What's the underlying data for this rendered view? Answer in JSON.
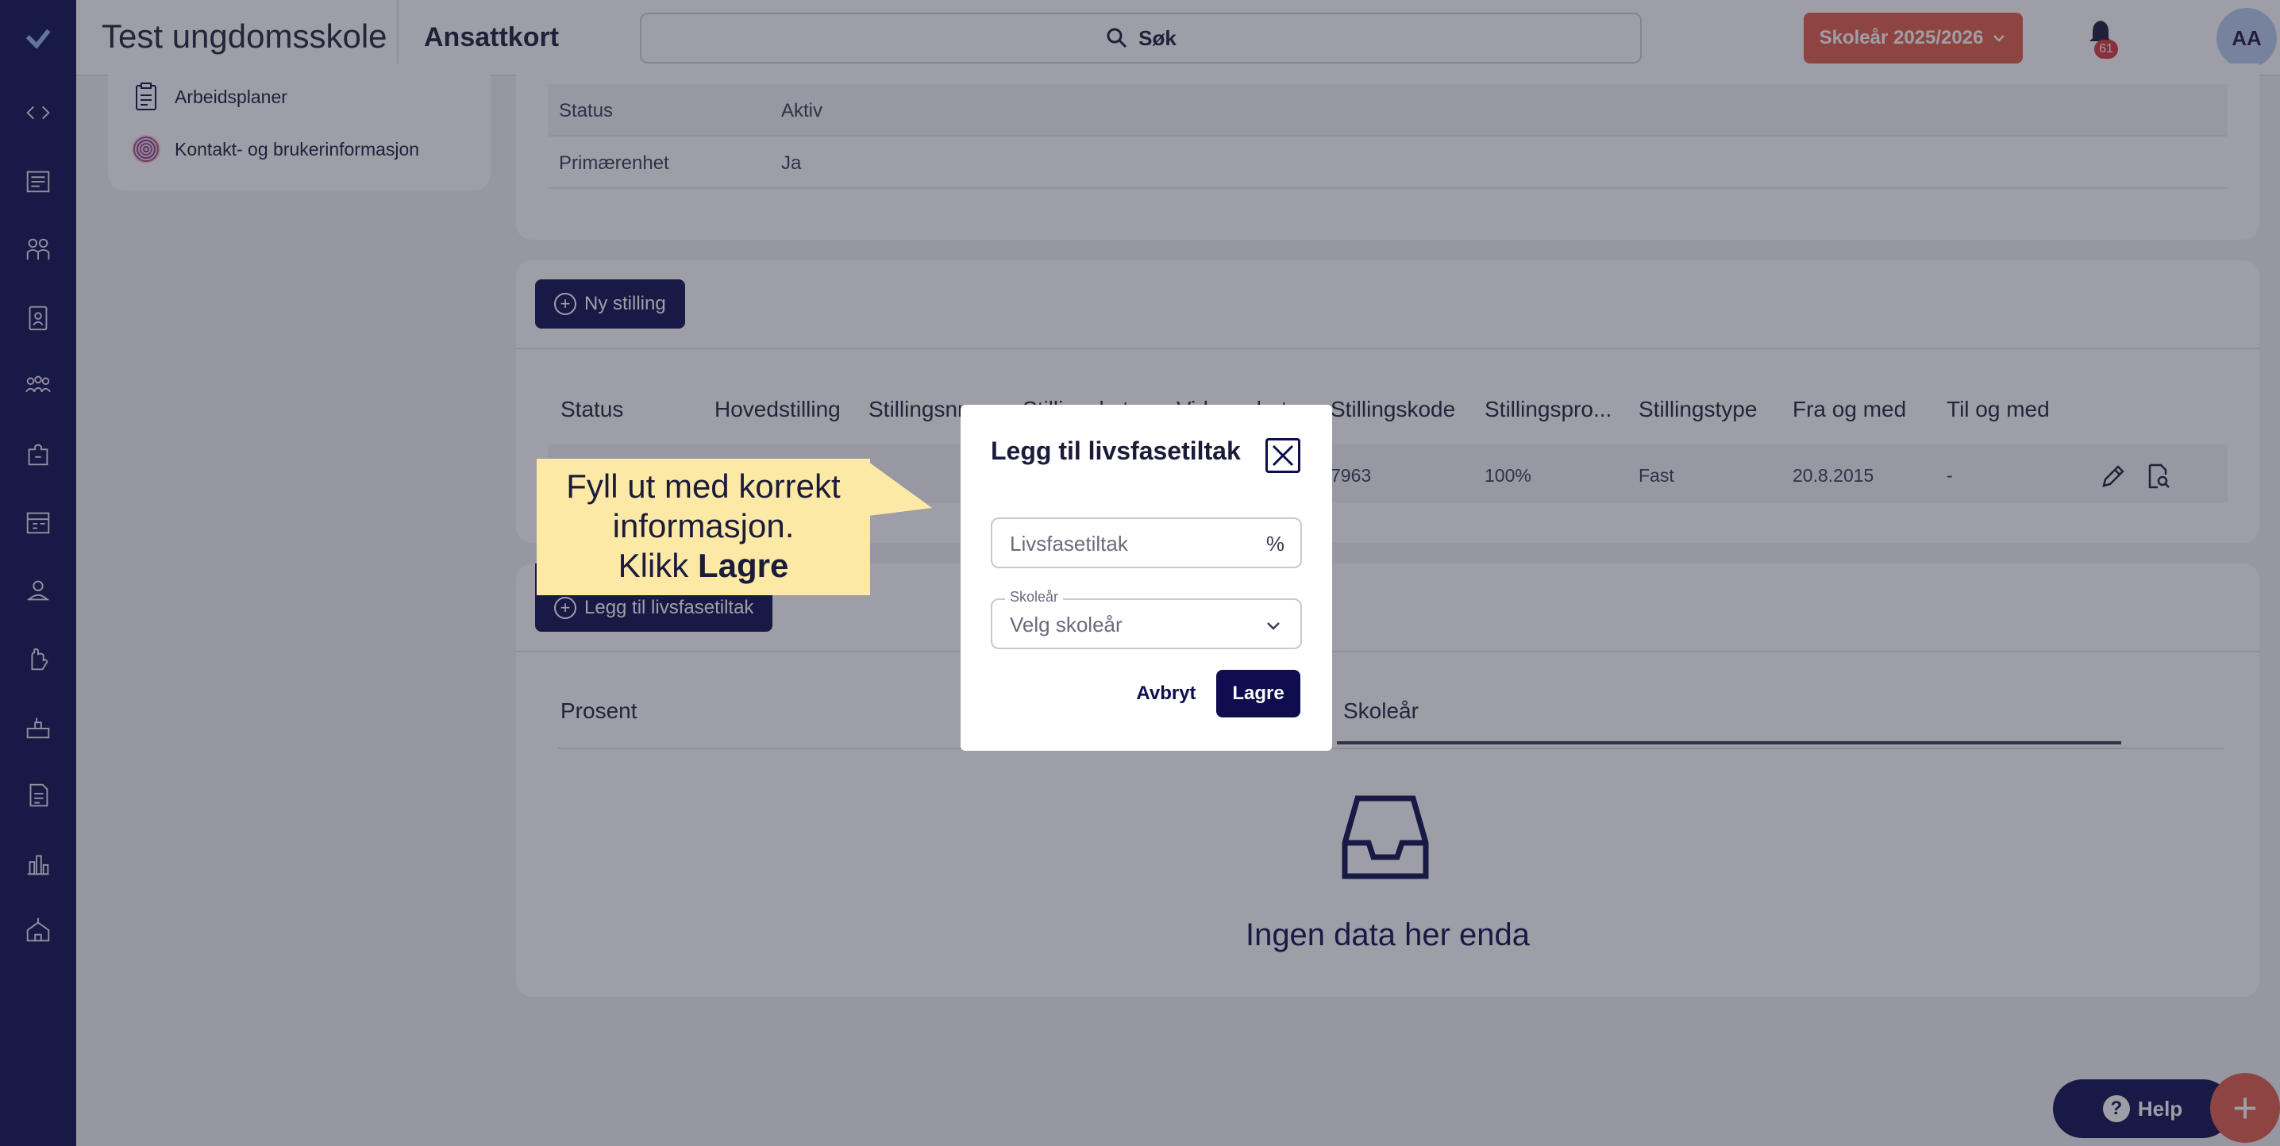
{
  "app": {
    "title": "Test ungdomsskole",
    "page_title": "Ansattkort"
  },
  "search": {
    "label": "Søk"
  },
  "school_year_button": {
    "label": "Skoleår 2025/2026"
  },
  "notifications": {
    "count": "61"
  },
  "user": {
    "initials": "AA"
  },
  "sidebar": {
    "icons": [
      "logo-icon",
      "code-toggle-icon",
      "newspaper-icon",
      "people-icon",
      "badge-icon",
      "group-icon",
      "puzzle-icon",
      "schedule-icon",
      "user-hand-icon",
      "hand-icon",
      "desk-icon",
      "document-icon",
      "bar-chart-icon",
      "school-icon"
    ]
  },
  "left_menu": {
    "items": [
      {
        "label": "Arbeidsplaner"
      },
      {
        "label": "Kontakt- og brukerinformasjon"
      }
    ]
  },
  "info": {
    "rows": [
      {
        "label": "Status",
        "value": "Aktiv"
      },
      {
        "label": "Primærenhet",
        "value": "Ja"
      }
    ]
  },
  "positions": {
    "new_button": "Ny stilling",
    "columns": [
      "Status",
      "Hovedstilling",
      "Stillingsnr...",
      "Stillingskat...",
      "Virksomhet...",
      "Stillingskode",
      "Stillingspro...",
      "Stillingstype",
      "Fra og med",
      "Til og med"
    ],
    "row": {
      "code": "7963",
      "percent": "100%",
      "type": "Fast",
      "from": "20.8.2015",
      "to": "-"
    }
  },
  "life_phase": {
    "add_button": "Legg til livsfasetiltak",
    "tabs": [
      "Prosent",
      "Skoleår"
    ],
    "empty_text": "Ingen data her enda"
  },
  "modal": {
    "title": "Legg til livsfasetiltak",
    "percent_field": {
      "placeholder": "Livsfasetiltak",
      "suffix": "%"
    },
    "year_field": {
      "label": "Skoleår",
      "placeholder": "Velg skoleår"
    },
    "cancel": "Avbryt",
    "save": "Lagre"
  },
  "tooltip": {
    "line1": "Fyll ut med korrekt",
    "line2": "informasjon.",
    "line3_prefix": "Klikk ",
    "line3_bold": "Lagre"
  },
  "help": {
    "label": "Help"
  },
  "fab": {
    "label": "+"
  },
  "colors": {
    "navy": "#0d0d4f",
    "accent": "#e25b45",
    "tooltip": "#fde9a6"
  }
}
